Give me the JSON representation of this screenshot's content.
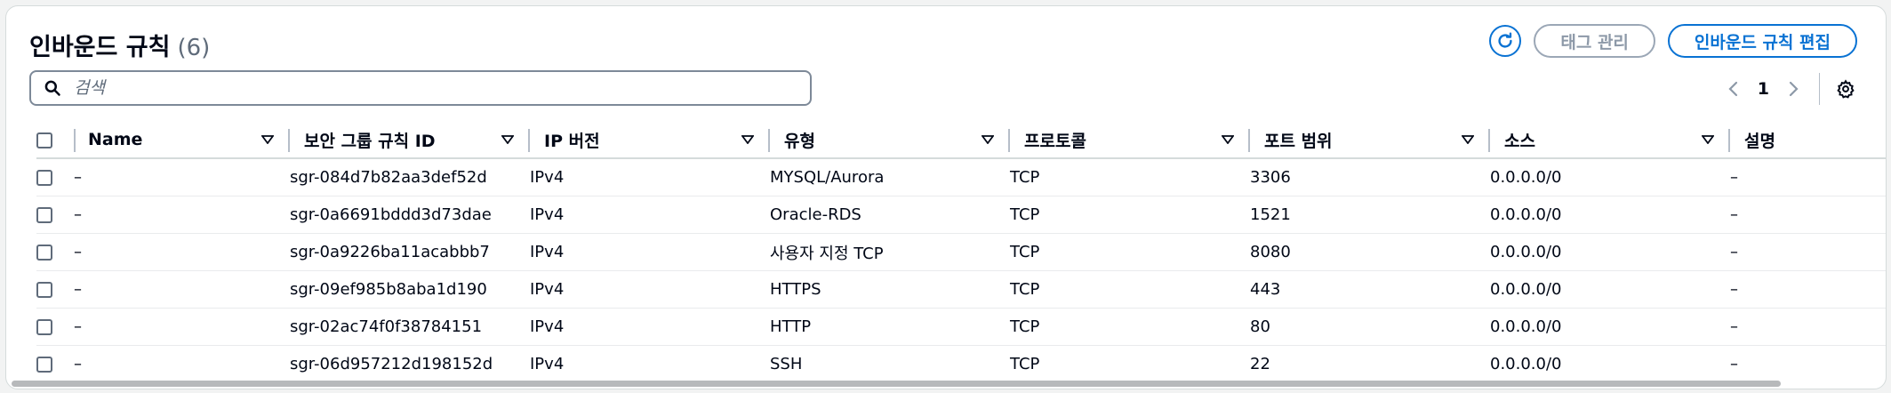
{
  "header": {
    "title": "인바운드 규칙",
    "count": "(6)"
  },
  "actions": {
    "refresh_label": "refresh-icon",
    "manage_tags": "태그 관리",
    "edit_inbound_rules": "인바운드 규칙 편집"
  },
  "search": {
    "placeholder": "검색",
    "value": ""
  },
  "pagination": {
    "current_page": "1"
  },
  "table": {
    "columns": [
      "Name",
      "보안 그룹 규칙 ID",
      "IP 버전",
      "유형",
      "프로토콜",
      "포트 범위",
      "소스",
      "설명"
    ],
    "rows": [
      {
        "name": "–",
        "rule_id": "sgr-084d7b82aa3def52d",
        "ip_version": "IPv4",
        "type": "MYSQL/Aurora",
        "protocol": "TCP",
        "port_range": "3306",
        "source": "0.0.0.0/0",
        "description": "–"
      },
      {
        "name": "–",
        "rule_id": "sgr-0a6691bddd3d73dae",
        "ip_version": "IPv4",
        "type": "Oracle-RDS",
        "protocol": "TCP",
        "port_range": "1521",
        "source": "0.0.0.0/0",
        "description": "–"
      },
      {
        "name": "–",
        "rule_id": "sgr-0a9226ba11acabbb7",
        "ip_version": "IPv4",
        "type": "사용자 지정 TCP",
        "protocol": "TCP",
        "port_range": "8080",
        "source": "0.0.0.0/0",
        "description": "–"
      },
      {
        "name": "–",
        "rule_id": "sgr-09ef985b8aba1d190",
        "ip_version": "IPv4",
        "type": "HTTPS",
        "protocol": "TCP",
        "port_range": "443",
        "source": "0.0.0.0/0",
        "description": "–"
      },
      {
        "name": "–",
        "rule_id": "sgr-02ac74f0f38784151",
        "ip_version": "IPv4",
        "type": "HTTP",
        "protocol": "TCP",
        "port_range": "80",
        "source": "0.0.0.0/0",
        "description": "–"
      },
      {
        "name": "–",
        "rule_id": "sgr-06d957212d198152d",
        "ip_version": "IPv4",
        "type": "SSH",
        "protocol": "TCP",
        "port_range": "22",
        "source": "0.0.0.0/0",
        "description": "–"
      }
    ]
  },
  "colors": {
    "accent": "#0972d3",
    "disabled": "#8d99a8",
    "text": "#000716",
    "muted": "#5f6b7a"
  }
}
